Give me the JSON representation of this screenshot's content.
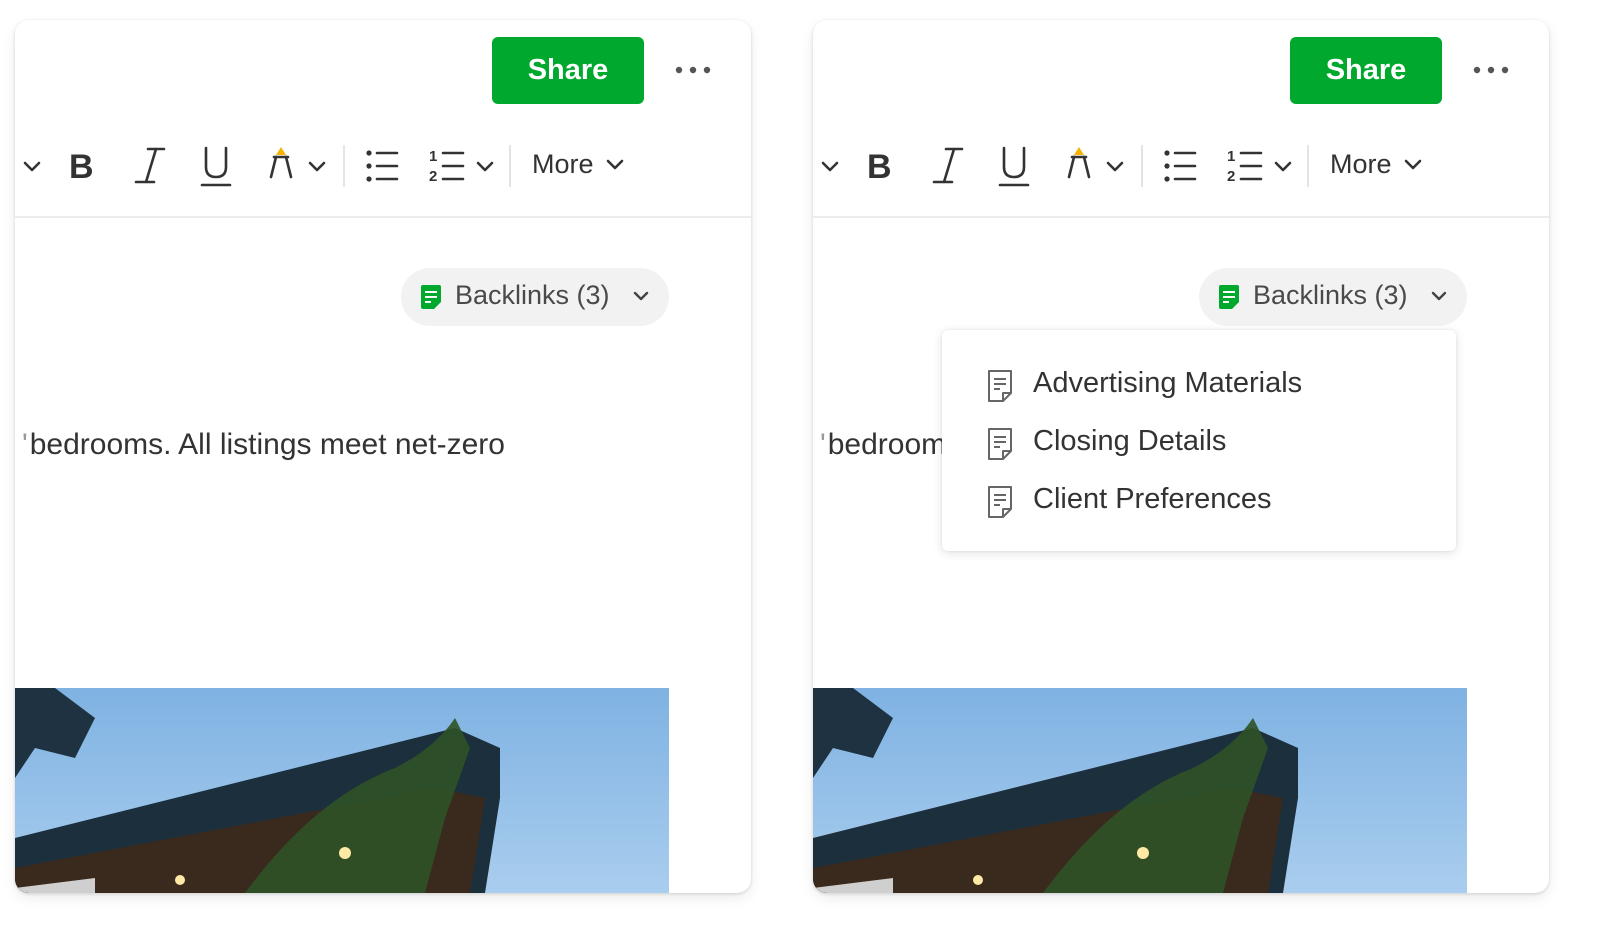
{
  "colors": {
    "accent": "#00a82d",
    "highlighter": "#f4b400",
    "text": "#333333"
  },
  "panels": [
    {
      "share_label": "Share",
      "more_options_icon": "more-horizontal-icon",
      "toolbar": {
        "icons": [
          "chevron-down-icon",
          "bold-icon",
          "italic-icon",
          "underline-icon",
          "highlighter-icon",
          "bulleted-list-icon",
          "numbered-list-icon"
        ],
        "more_label": "More"
      },
      "backlinks": {
        "icon": "note-icon",
        "label": "Backlinks (3)"
      },
      "body_text": "bedrooms. All listings meet net-zero",
      "image": "house-photo"
    },
    {
      "share_label": "Share",
      "more_options_icon": "more-horizontal-icon",
      "toolbar": {
        "icons": [
          "chevron-down-icon",
          "bold-icon",
          "italic-icon",
          "underline-icon",
          "highlighter-icon",
          "bulleted-list-icon",
          "numbered-list-icon"
        ],
        "more_label": "More"
      },
      "backlinks": {
        "icon": "note-icon",
        "label": "Backlinks (3)",
        "items": [
          {
            "label": "Advertising Materials",
            "icon": "document-icon"
          },
          {
            "label": "Closing Details",
            "icon": "document-icon"
          },
          {
            "label": "Client Preferences",
            "icon": "document-icon"
          }
        ]
      },
      "body_text": "bedroom",
      "image": "house-photo"
    }
  ]
}
